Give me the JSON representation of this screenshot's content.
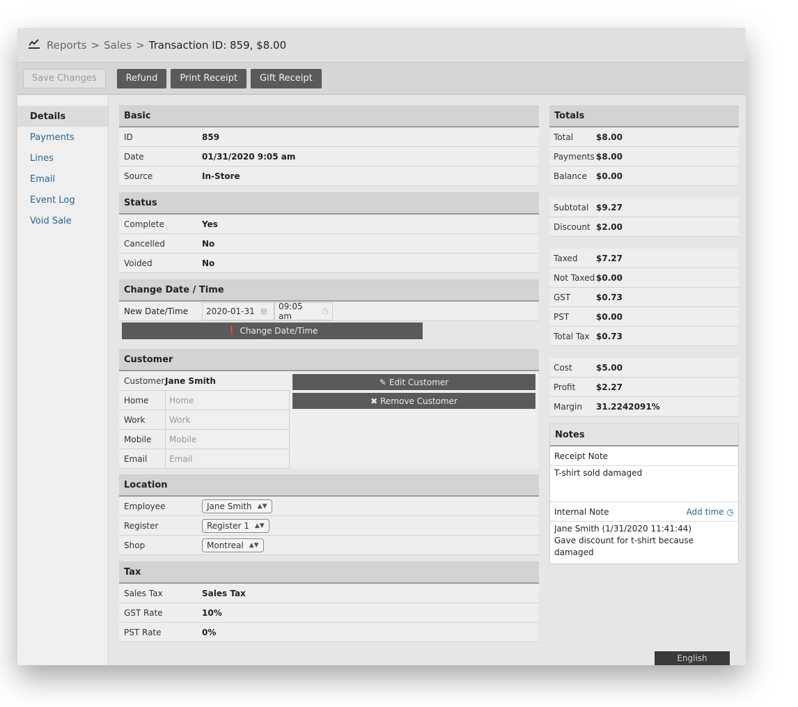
{
  "breadcrumb": {
    "icon": "chart-line-icon",
    "items": [
      "Reports",
      "Sales"
    ],
    "current": "Transaction ID: 859, $8.00",
    "separator": ">"
  },
  "toolbar": {
    "save_label": "Save Changes",
    "refund_label": "Refund",
    "print_label": "Print Receipt",
    "gift_label": "Gift Receipt"
  },
  "sidebar": {
    "items": [
      {
        "label": "Details",
        "active": true
      },
      {
        "label": "Payments"
      },
      {
        "label": "Lines"
      },
      {
        "label": "Email"
      },
      {
        "label": "Event Log"
      },
      {
        "label": "Void Sale"
      }
    ]
  },
  "basic": {
    "title": "Basic",
    "rows": [
      {
        "label": "ID",
        "value": "859"
      },
      {
        "label": "Date",
        "value": "01/31/2020 9:05 am"
      },
      {
        "label": "Source",
        "value": "In-Store"
      }
    ]
  },
  "status": {
    "title": "Status",
    "rows": [
      {
        "label": "Complete",
        "value": "Yes"
      },
      {
        "label": "Cancelled",
        "value": "No"
      },
      {
        "label": "Voided",
        "value": "No"
      }
    ]
  },
  "change_date": {
    "title": "Change Date / Time",
    "label": "New Date/Time",
    "date_value": "2020-01-31",
    "time_value": "09:05 am",
    "button_label": "Change Date/Time"
  },
  "customer": {
    "title": "Customer",
    "label": "Customer",
    "name": "Jane Smith",
    "fields": [
      {
        "label": "Home",
        "placeholder": "Home"
      },
      {
        "label": "Work",
        "placeholder": "Work"
      },
      {
        "label": "Mobile",
        "placeholder": "Mobile"
      },
      {
        "label": "Email",
        "placeholder": "Email"
      }
    ],
    "edit_label": "Edit Customer",
    "remove_label": "Remove Customer"
  },
  "location": {
    "title": "Location",
    "rows": [
      {
        "label": "Employee",
        "value": "Jane Smith"
      },
      {
        "label": "Register",
        "value": "Register 1"
      },
      {
        "label": "Shop",
        "value": "Montreal"
      }
    ]
  },
  "tax": {
    "title": "Tax",
    "rows": [
      {
        "label": "Sales Tax",
        "value": "Sales Tax"
      },
      {
        "label": "GST Rate",
        "value": "10%"
      },
      {
        "label": "PST Rate",
        "value": "0%"
      }
    ]
  },
  "totals": {
    "title": "Totals",
    "group1": [
      {
        "label": "Total",
        "value": "$8.00"
      },
      {
        "label": "Payments",
        "value": "$8.00"
      },
      {
        "label": "Balance",
        "value": "$0.00"
      }
    ],
    "group2": [
      {
        "label": "Subtotal",
        "value": "$9.27"
      },
      {
        "label": "Discount",
        "value": "$2.00"
      }
    ],
    "group3": [
      {
        "label": "Taxed",
        "value": "$7.27"
      },
      {
        "label": "Not Taxed",
        "value": "$0.00"
      },
      {
        "label": "GST",
        "value": "$0.73"
      },
      {
        "label": "PST",
        "value": "$0.00"
      },
      {
        "label": "Total Tax",
        "value": "$0.73"
      }
    ],
    "group4": [
      {
        "label": "Cost",
        "value": "$5.00"
      },
      {
        "label": "Profit",
        "value": "$2.27"
      },
      {
        "label": "Margin",
        "value": "31.2242091%"
      }
    ]
  },
  "notes": {
    "title": "Notes",
    "receipt_label": "Receipt Note",
    "receipt_value": "T-shirt sold damaged",
    "internal_label": "Internal Note",
    "add_time_label": "Add time",
    "internal_line1": "Jane Smith (1/31/2020 11:41:44)",
    "internal_line2": "Gave discount for t-shirt because damaged"
  },
  "language": "English"
}
